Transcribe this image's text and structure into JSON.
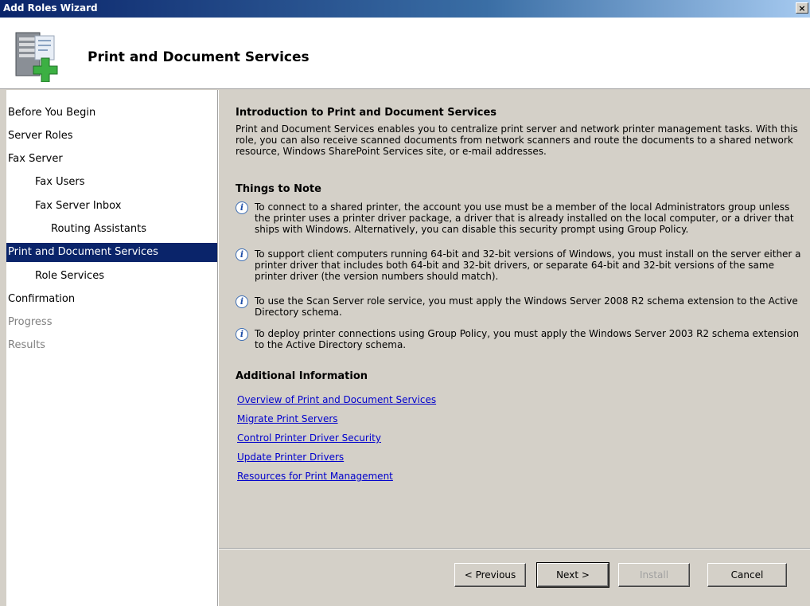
{
  "window": {
    "title": "Add Roles Wizard",
    "close_label": "×"
  },
  "header": {
    "title": "Print and Document Services",
    "icon": "server-add-icon"
  },
  "nav": [
    {
      "label": "Before You Begin",
      "level": 1,
      "state": "normal"
    },
    {
      "label": "Server Roles",
      "level": 1,
      "state": "normal"
    },
    {
      "label": "Fax Server",
      "level": 1,
      "state": "normal"
    },
    {
      "label": "Fax Users",
      "level": 2,
      "state": "normal"
    },
    {
      "label": "Fax Server Inbox",
      "level": 2,
      "state": "normal"
    },
    {
      "label": "Routing Assistants",
      "level": 3,
      "state": "normal"
    },
    {
      "label": "Print and Document Services",
      "level": 1,
      "state": "active"
    },
    {
      "label": "Role Services",
      "level": 2,
      "state": "normal"
    },
    {
      "label": "Confirmation",
      "level": 1,
      "state": "normal"
    },
    {
      "label": "Progress",
      "level": 1,
      "state": "disabled"
    },
    {
      "label": "Results",
      "level": 1,
      "state": "disabled"
    }
  ],
  "content": {
    "intro_heading": "Introduction to Print and Document Services",
    "intro_text": "Print and Document Services enables you to centralize print server and network printer management tasks. With this role, you can also receive scanned documents from network scanners and route the documents to a shared network resource, Windows SharePoint Services site, or e-mail addresses.",
    "notes_heading": "Things to Note",
    "notes": [
      "To connect to a shared printer, the account you use must be a member of the local Administrators group unless the printer uses a printer driver package, a driver that is already installed on the local computer, or a driver that ships with Windows. Alternatively, you can disable this security prompt using Group Policy.",
      "To support client computers running 64-bit and 32-bit versions of Windows, you must install on the server either a printer driver that includes both 64-bit and 32-bit drivers, or separate 64-bit and 32-bit versions of the same printer driver (the version numbers should match).",
      "To use the Scan Server role service, you must apply the Windows Server 2008 R2 schema extension to the Active Directory schema.",
      "To deploy printer connections using Group Policy, you must apply the Windows Server 2003 R2 schema extension to the Active Directory schema."
    ],
    "info_heading": "Additional Information",
    "links": [
      "Overview of Print and Document Services",
      "Migrate Print Servers",
      "Control Printer Driver Security",
      "Update Printer Drivers",
      "Resources for Print Management"
    ]
  },
  "buttons": {
    "previous": "< Previous",
    "next": "Next >",
    "install": "Install",
    "cancel": "Cancel"
  },
  "colors": {
    "selection": "#0a246a",
    "link": "#0000cc",
    "dialog": "#d4d0c8"
  }
}
